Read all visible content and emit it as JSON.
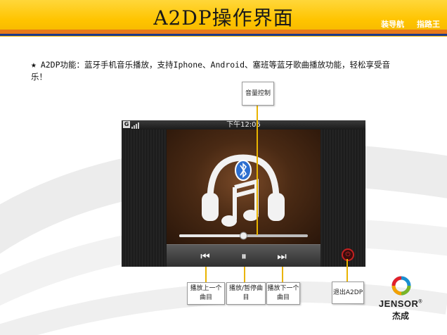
{
  "header": {
    "title": "A2DP操作界面",
    "brand_left": "装导航",
    "brand_right": "指路王"
  },
  "description": {
    "star": "★",
    "text": "A2DP功能：蓝牙手机音乐播放，支持Iphone、Android、塞班等蓝牙歌曲播放功能，轻松享受音乐！"
  },
  "phone": {
    "status_icon": "G",
    "clock": "下午12:05",
    "controls": {
      "prev_icon": "previous-track-icon",
      "pause_icon": "pause-icon",
      "next_icon": "next-track-icon",
      "prev_glyph": "⏮",
      "pause_glyph": "⏸",
      "next_glyph": "⏭",
      "power_glyph": "⏻"
    },
    "volume_level": 0.5
  },
  "callouts": {
    "volume": "音量控制",
    "prev": "播放上一个曲目",
    "pause": "播放/暂停曲目",
    "next": "播放下一个曲目",
    "exit": "退出A2DP"
  },
  "logo": {
    "name": "JENSOR",
    "reg": "®",
    "cn": "杰成"
  },
  "colors": {
    "header_yellow": "#ffc400",
    "header_orange": "#e8791a",
    "header_blue": "#1c3a8c",
    "lead_line": "#e9b400",
    "power_red": "#c62020"
  }
}
